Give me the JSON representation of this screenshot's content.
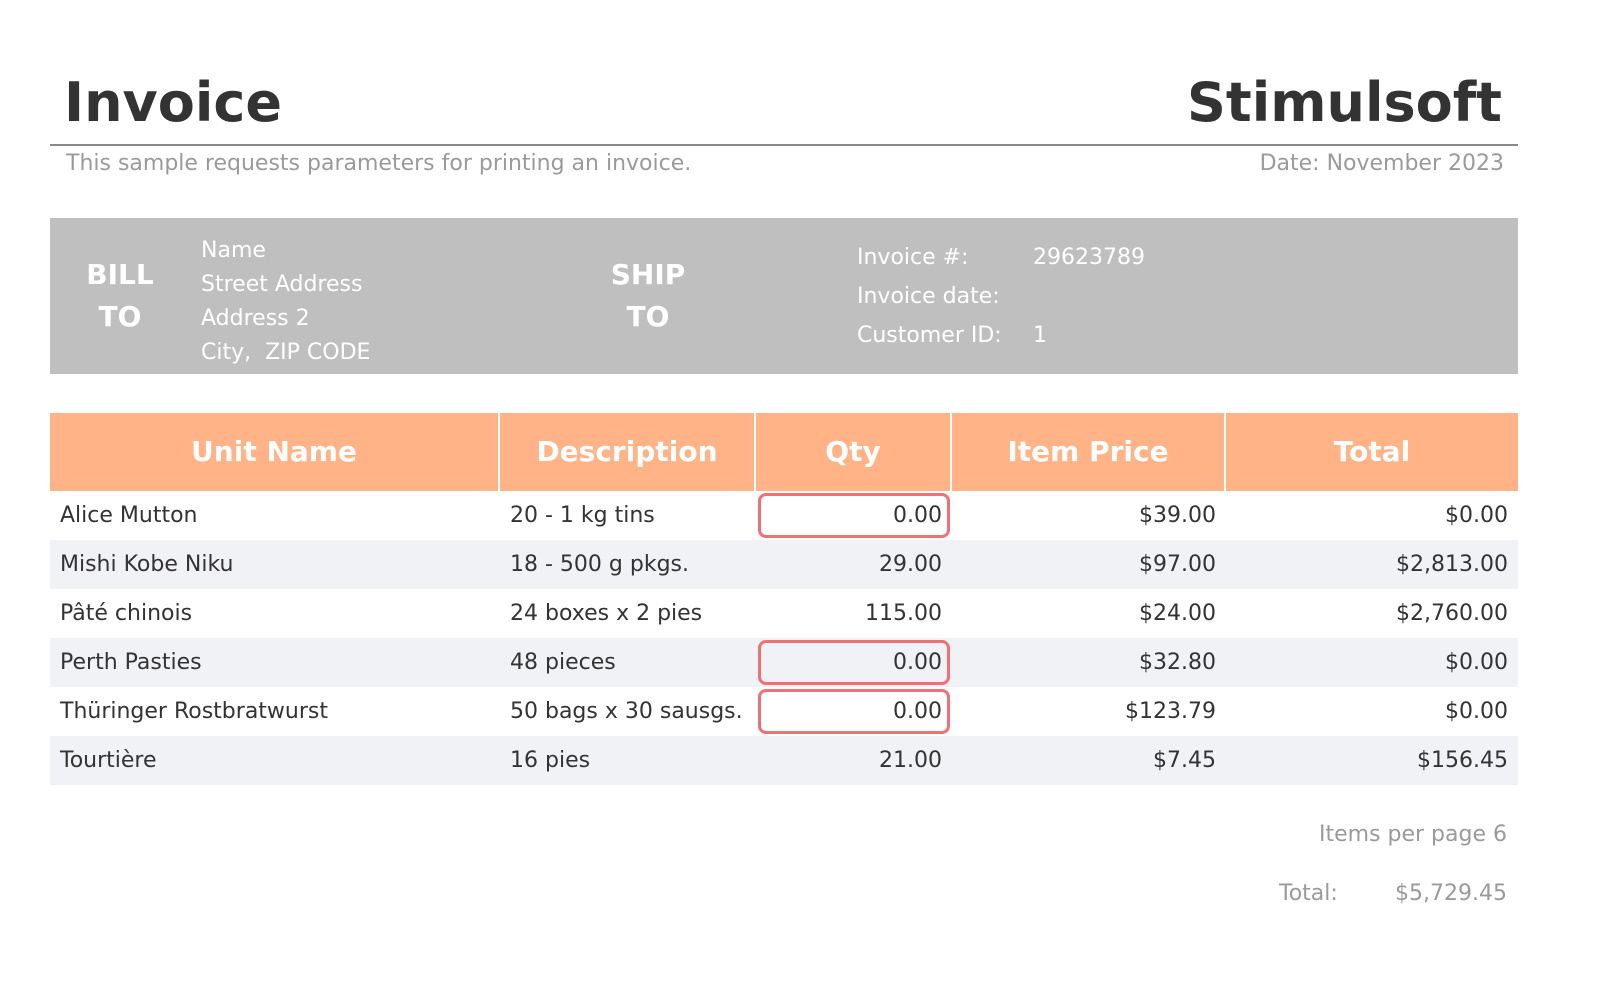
{
  "header": {
    "title": "Invoice",
    "company": "Stimulsoft",
    "subtitle": "This sample requests parameters for printing an invoice.",
    "date": "Date: November 2023"
  },
  "info_band": {
    "bill_label_1": "BILL",
    "bill_label_2": "TO",
    "ship_label_1": "SHIP",
    "ship_label_2": "TO",
    "bill_to": {
      "name": "Name",
      "street": "Street Address",
      "address2": "Address 2",
      "city_zip": "City,  ZIP CODE"
    },
    "invoice_meta": [
      {
        "label": "Invoice #:",
        "value": "29623789"
      },
      {
        "label": "Invoice date:",
        "value": ""
      },
      {
        "label": "Customer ID:",
        "value": "1"
      }
    ]
  },
  "table": {
    "columns": [
      "Unit Name",
      "Description",
      "Qty",
      "Item Price",
      "Total"
    ],
    "rows": [
      {
        "unit": "Alice Mutton",
        "description": "20 - 1 kg tins",
        "qty": "0.00",
        "price": "$39.00",
        "total": "$0.00",
        "qty_flagged": true
      },
      {
        "unit": "Mishi Kobe Niku",
        "description": "18 - 500 g pkgs.",
        "qty": "29.00",
        "price": "$97.00",
        "total": "$2,813.00",
        "qty_flagged": false
      },
      {
        "unit": "Pâté chinois",
        "description": "24 boxes x 2 pies",
        "qty": "115.00",
        "price": "$24.00",
        "total": "$2,760.00",
        "qty_flagged": false
      },
      {
        "unit": "Perth Pasties",
        "description": "48 pieces",
        "qty": "0.00",
        "price": "$32.80",
        "total": "$0.00",
        "qty_flagged": true
      },
      {
        "unit": "Thüringer Rostbratwurst",
        "description": "50 bags x 30 sausgs.",
        "qty": "0.00",
        "price": "$123.79",
        "total": "$0.00",
        "qty_flagged": true
      },
      {
        "unit": "Tourtière",
        "description": "16 pies",
        "qty": "21.00",
        "price": "$7.45",
        "total": "$156.45",
        "qty_flagged": false
      }
    ]
  },
  "footer": {
    "items_per_page": "Items per page 6",
    "total_label": "Total:",
    "total_value": "$5,729.45"
  },
  "colors": {
    "header_bg": "#ffb386",
    "band_bg": "#bfbfbf",
    "alt_row_bg": "#f1f2f5",
    "flag_border": "#f07075"
  }
}
